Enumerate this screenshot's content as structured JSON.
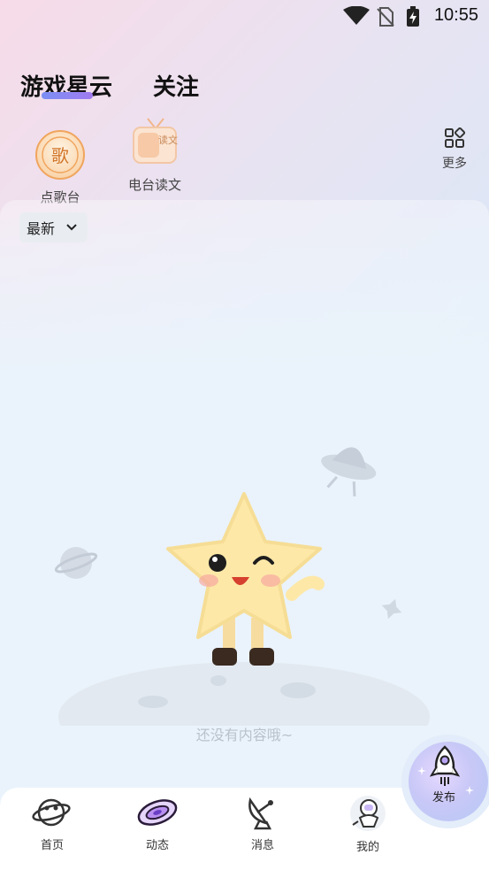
{
  "status_bar": {
    "time": "10:55"
  },
  "top_tabs": [
    {
      "label": "游戏星云",
      "active": true
    },
    {
      "label": "关注",
      "active": false
    }
  ],
  "shortcuts": [
    {
      "label": "点歌台",
      "icon": "song-request-icon",
      "icon_text": "歌"
    },
    {
      "label": "电台读文",
      "icon": "radio-tv-icon",
      "icon_text": "读文"
    }
  ],
  "more": {
    "label": "更多",
    "icon": "grid-icon"
  },
  "sort": {
    "label": "最新"
  },
  "empty_state": {
    "text": "还没有内容哦~",
    "illustration": "star-mascot-on-planet"
  },
  "fab": {
    "label": "发布",
    "icon": "rocket-icon"
  },
  "bottom_nav": [
    {
      "label": "首页",
      "icon": "planet-icon"
    },
    {
      "label": "动态",
      "icon": "galaxy-icon",
      "active": true
    },
    {
      "label": "消息",
      "icon": "satellite-dish-icon"
    },
    {
      "label": "我的",
      "icon": "astronaut-icon"
    }
  ],
  "colors": {
    "accent": "#8f7cf0",
    "mascot": "#fde8a8",
    "muted_text": "#b9c2cc"
  }
}
